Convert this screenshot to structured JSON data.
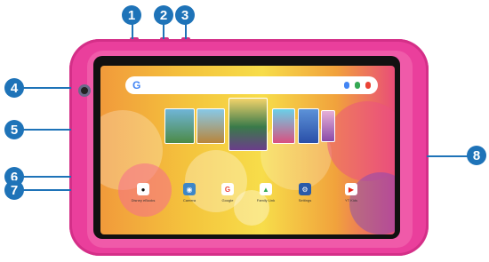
{
  "callouts": [
    "1",
    "2",
    "3",
    "4",
    "5",
    "6",
    "7",
    "8"
  ],
  "search": {
    "logo": "G",
    "placeholder": ""
  },
  "apps": [
    {
      "label": "Disney eBooks",
      "icon": "mickey-icon",
      "color": "#ffffff",
      "glyph": "●"
    },
    {
      "label": "Camera",
      "icon": "camera-icon",
      "color": "#3d86c8",
      "glyph": "◉"
    },
    {
      "label": "Google",
      "icon": "google-icon",
      "color": "#ffffff",
      "glyph": "G"
    },
    {
      "label": "Family Link",
      "icon": "family-link-icon",
      "color": "#ffffff",
      "glyph": "▲"
    },
    {
      "label": "Settings",
      "icon": "settings-icon",
      "color": "#2a5aa8",
      "glyph": "⚙"
    },
    {
      "label": "YT Kids",
      "icon": "yt-kids-icon",
      "color": "#ffffff",
      "glyph": "▶"
    }
  ],
  "brand": "",
  "colors": {
    "callout": "#1e73b8",
    "bumper": "#ea3f9c",
    "bezel": "#111111"
  }
}
